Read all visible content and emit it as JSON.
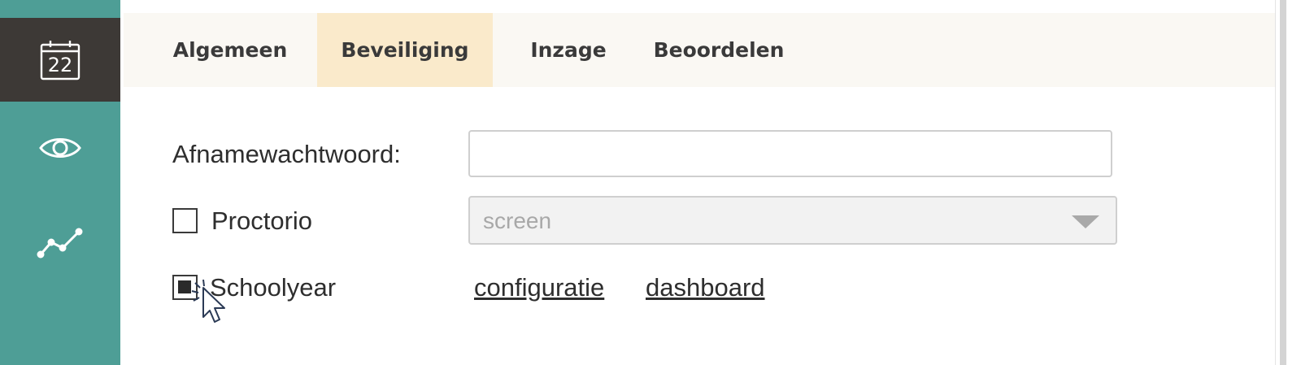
{
  "sidebar": {
    "items": [
      {
        "icon": "calendar-icon",
        "label": "22",
        "active": true
      },
      {
        "icon": "eye-icon",
        "active": false
      },
      {
        "icon": "trend-line-icon",
        "active": false
      }
    ]
  },
  "tabs": [
    {
      "label": "Algemeen",
      "active": false
    },
    {
      "label": "Beveiliging",
      "active": true
    },
    {
      "label": "Inzage",
      "active": false
    },
    {
      "label": "Beoordelen",
      "active": false
    }
  ],
  "form": {
    "password_label": "Afnamewachtwoord:",
    "password_value": "",
    "proctorio_label": "Proctorio",
    "proctorio_checked": false,
    "proctorio_select_value": "screen",
    "schoolyear_label": "Schoolyear",
    "schoolyear_checked": true,
    "links": {
      "configuration": "configuratie",
      "dashboard": "dashboard"
    }
  },
  "colors": {
    "sidebar": "#4e9e96",
    "sidebar_active": "#3d3936",
    "tabbar": "#faf8f3",
    "tab_active": "#faeacb"
  }
}
